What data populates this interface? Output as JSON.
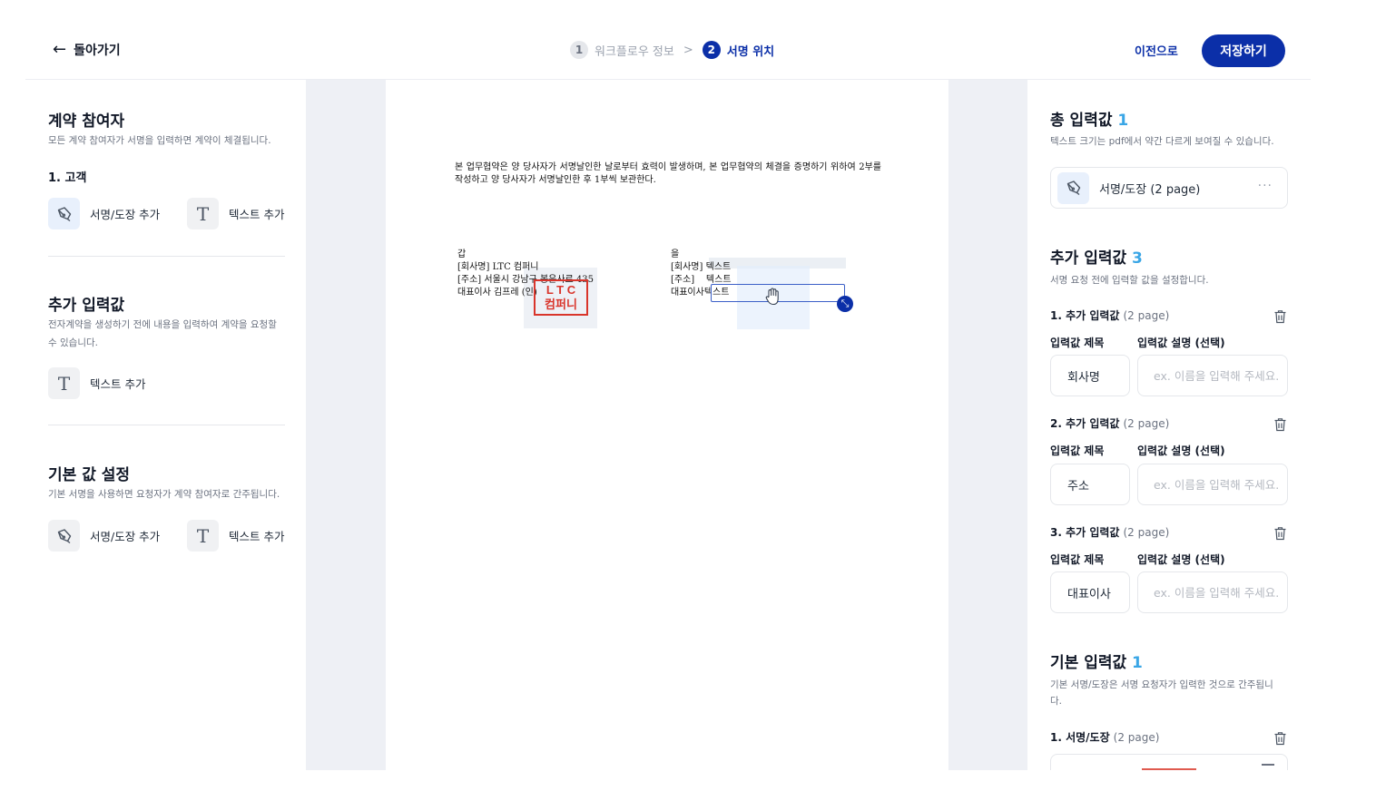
{
  "header": {
    "back_label": "돌아가기",
    "steps": [
      {
        "num": "1",
        "label": "워크플로우 정보"
      },
      {
        "num": "2",
        "label": "서명 위치"
      }
    ],
    "step_separator": ">",
    "prev_label": "이전으로",
    "save_label": "저장하기"
  },
  "left": {
    "participants": {
      "title": "계약 참여자",
      "desc": "모든 계약 참여자가 서명을 입력하면 계약이 체결됩니다.",
      "customer_label": "1. 고객",
      "sign_btn": "서명/도장 추가",
      "text_btn": "텍스트 추가"
    },
    "extra": {
      "title": "추가 입력값",
      "desc": "전자계약을 생성하기 전에 내용을 입력하여 계약을 요청할 수 있습니다.",
      "text_btn": "텍스트 추가"
    },
    "defaults": {
      "title": "기본 값 설정",
      "desc": "기본 서명을 사용하면 요청자가 계약 참여자로 간주됩니다.",
      "sign_btn": "서명/도장 추가",
      "text_btn": "텍스트 추가"
    }
  },
  "document": {
    "paragraph": "본 업무협약은 양 당사자가 서명날인한 날로부터 효력이 발생하며, 본 업무협약의 체결을 증명하기 위하여 2부를 작성하고 양 당사자가 서명날인한 후 1부씩 보관한다.",
    "party_a": {
      "heading": "갑",
      "company": "[회사명] LTC 컴퍼니",
      "address": "[주소] 서울시 강남구 봉은사로 435",
      "ceo": "대표이사   김프레 (인)"
    },
    "party_b": {
      "heading": "을",
      "company_label": "[회사명]",
      "company_value": "텍스트",
      "address_label": "[주소]",
      "address_value": "텍스트",
      "ceo_label": "대표이사",
      "ceo_value": "텍스트"
    },
    "seal_text": "L T C\n컴퍼니"
  },
  "right": {
    "total": {
      "title": "총 입력값",
      "count": "1",
      "desc": "텍스트 크기는 pdf에서 약간 다르게 보여질 수 있습니다.",
      "card_label": "서명/도장 (2 page)",
      "card_more": "···"
    },
    "extra": {
      "title": "추가 입력값",
      "count": "3",
      "desc": "서명 요청 전에 입력할 값을 설정합니다.",
      "col_title": "입력값 제목",
      "col_desc": "입력값 설명 (선택)",
      "placeholder": "ex. 이름을 입력해 주세요.",
      "items": [
        {
          "head": "1. 추가 입력값",
          "page": "(2 page)",
          "value": "회사명"
        },
        {
          "head": "2. 추가 입력값",
          "page": "(2 page)",
          "value": "주소"
        },
        {
          "head": "3. 추가 입력값",
          "page": "(2 page)",
          "value": "대표이사"
        }
      ]
    },
    "basic": {
      "title": "기본 입력값",
      "count": "1",
      "desc": "기본 서명/도장은 서명 요청자가 입력한 것으로 간주됩니다.",
      "item_head": "1. 서명/도장",
      "item_page": "(2 page)"
    }
  },
  "colors": {
    "primary": "#0b2fa8",
    "count_accent": "#3aa6e6",
    "seal_red": "#d9352b",
    "doc_bg": "#eef0f5"
  }
}
